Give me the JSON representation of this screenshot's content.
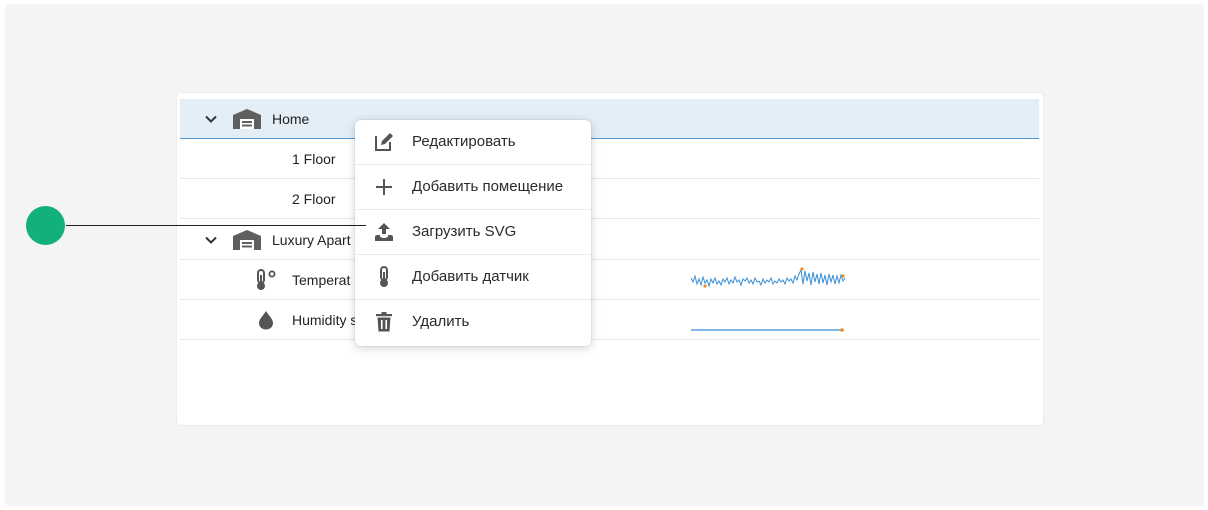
{
  "tree": {
    "rows": [
      {
        "label": "Home"
      },
      {
        "label": "1 Floor"
      },
      {
        "label": "2 Floor"
      },
      {
        "label": "Luxury Apart"
      },
      {
        "label": "Temperat"
      },
      {
        "label": "Humidity s"
      }
    ]
  },
  "context_menu": {
    "items": [
      {
        "label": "Редактировать",
        "icon": "edit-icon"
      },
      {
        "label": "Добавить помещение",
        "icon": "plus-icon"
      },
      {
        "label": "Загрузить SVG",
        "icon": "upload-icon"
      },
      {
        "label": "Добавить датчик",
        "icon": "thermometer-icon"
      },
      {
        "label": "Удалить",
        "icon": "trash-icon"
      }
    ]
  },
  "colors": {
    "selected_row_bg": "#e3eef7",
    "selected_row_border": "#4f9ad6",
    "sparkline": "#3a8fd6",
    "sparkline_marker": "#f08a24",
    "callout_dot": "#12b07a"
  }
}
